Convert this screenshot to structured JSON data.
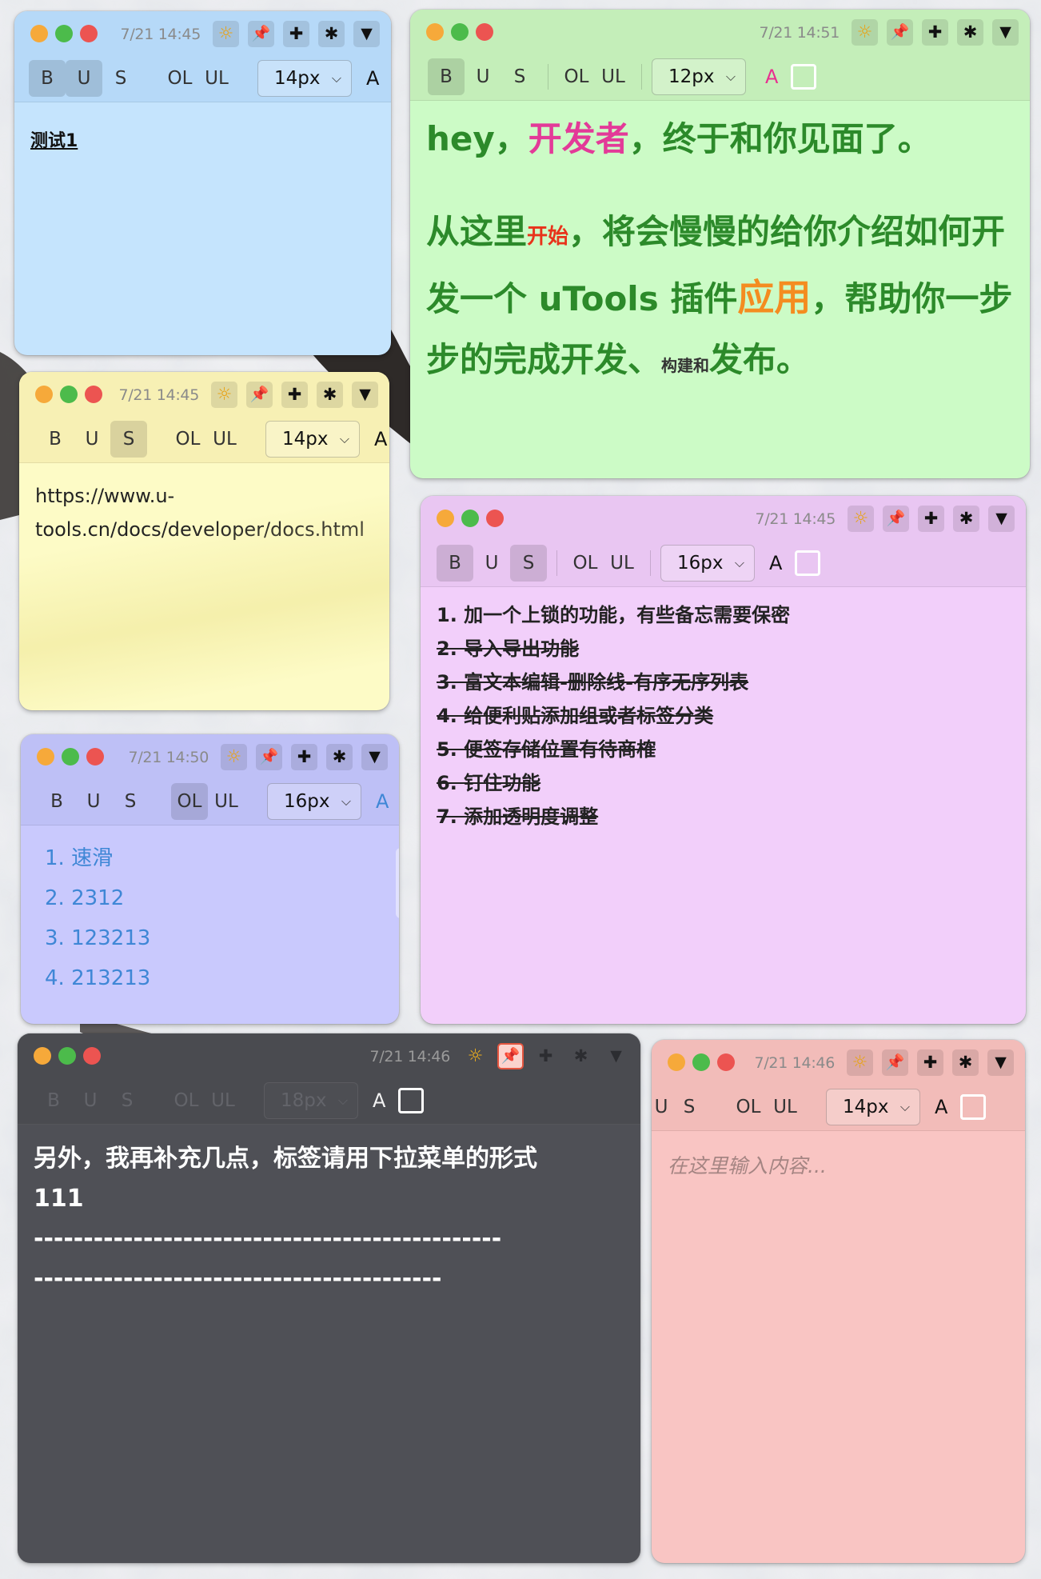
{
  "notes": [
    {
      "id": "n1",
      "timestamp": "7/21 14:45",
      "toolbar": {
        "bold": "B",
        "underline": "U",
        "strike": "S",
        "ol": "OL",
        "ul": "UL",
        "font_size": "14px",
        "color": "A"
      },
      "body": "测试1"
    },
    {
      "id": "n2",
      "timestamp": "7/21 14:51",
      "toolbar": {
        "bold": "B",
        "underline": "U",
        "strike": "S",
        "ol": "OL",
        "ul": "UL",
        "font_size": "12px",
        "color": "A"
      },
      "line1": [
        "hey，",
        "开发者",
        "，终于和你见面了。"
      ],
      "line2": [
        "从这里",
        "开始",
        "，将会慢慢的给你介绍如何开发一个 uTools 插件",
        "应用",
        "，帮助你一步步的完成开发、",
        "构建和",
        "发布。"
      ]
    },
    {
      "id": "n3",
      "timestamp": "7/21 14:45",
      "toolbar": {
        "bold": "B",
        "underline": "U",
        "strike": "S",
        "ol": "OL",
        "ul": "UL",
        "font_size": "14px",
        "color": "A"
      },
      "body_lines": [
        "https://www.u-",
        "tools.cn/docs/developer/docs.html"
      ]
    },
    {
      "id": "n4",
      "timestamp": "7/21 14:45",
      "toolbar": {
        "bold": "B",
        "underline": "U",
        "strike": "S",
        "ol": "OL",
        "ul": "UL",
        "font_size": "16px",
        "color": "A"
      },
      "items": [
        "1. 加一个上锁的功能，有些备忘需要保密",
        "2. 导入导出功能",
        "3. 富文本编辑-删除线-有序无序列表",
        "4. 给便利贴添加组或者标签分类",
        "5. 便签存储位置有待商榷",
        "6. 钉住功能",
        "7. 添加透明度调整"
      ]
    },
    {
      "id": "n5",
      "timestamp": "7/21 14:50",
      "toolbar": {
        "bold": "B",
        "underline": "U",
        "strike": "S",
        "ol": "OL",
        "ul": "UL",
        "font_size": "16px",
        "color": "A"
      },
      "items": [
        "1. 速滑",
        "2. 2312",
        "3. 123213",
        "4. 213213"
      ]
    },
    {
      "id": "n6",
      "timestamp": "7/21 14:46",
      "toolbar": {
        "bold": "B",
        "underline": "U",
        "strike": "S",
        "ol": "OL",
        "ul": "UL",
        "font_size": "18px",
        "color": "A"
      },
      "body_lines": [
        "另外，我再补充几点，标签请用下拉菜单的形式",
        "111",
        "-----------------------------------------------",
        "-----------------------------------------"
      ]
    },
    {
      "id": "n7",
      "timestamp": "7/21 14:46",
      "toolbar": {
        "underline": "U",
        "strike": "S",
        "ol": "OL",
        "ul": "UL",
        "font_size": "14px",
        "color": "A"
      },
      "placeholder": "在这里输入内容..."
    }
  ],
  "icons": {
    "theme": "sun-icon",
    "pin": "pin-icon",
    "add": "plus-icon",
    "settings": "asterisk-icon",
    "menu": "triangle-down-icon"
  },
  "colors": {
    "blue": "#c5e4fd",
    "green": "#ccfbc6",
    "yellow": "#fdfbc6",
    "purple": "#f2cffa",
    "lavender": "#c9c9fd",
    "dark": "#4f5056",
    "pink": "#f9c5c3"
  }
}
